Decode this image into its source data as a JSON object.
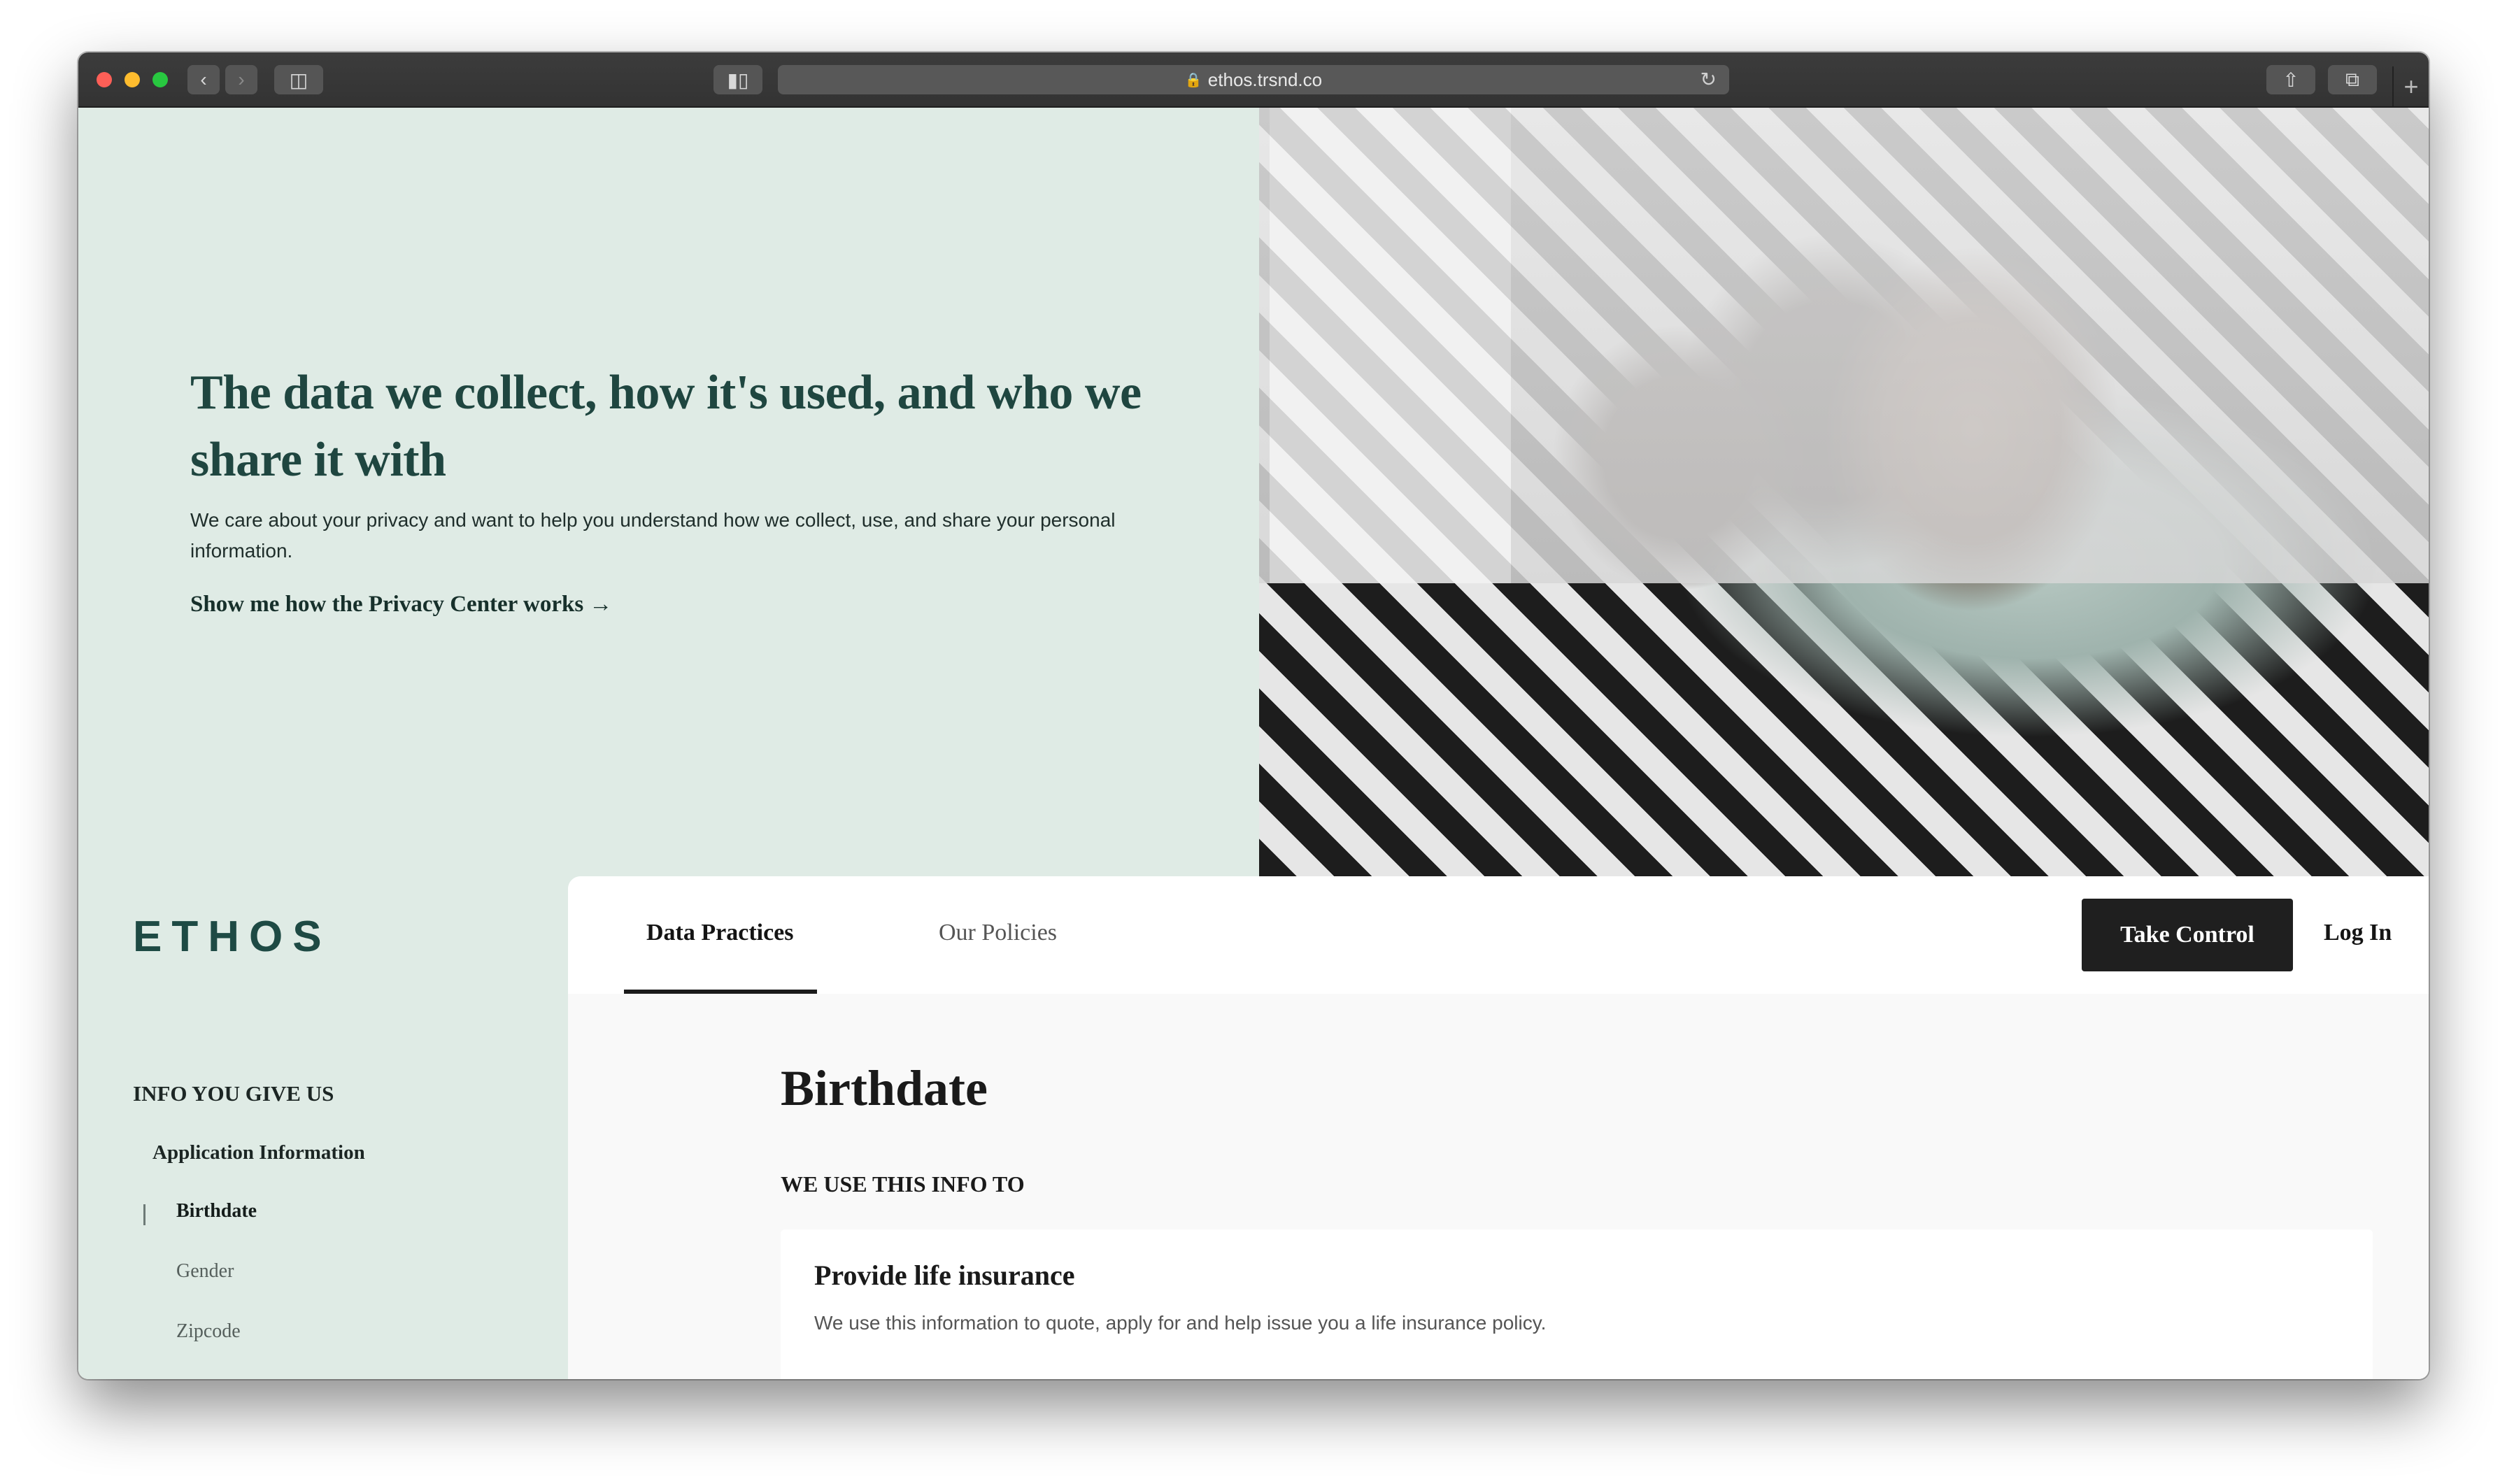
{
  "browser": {
    "url": "ethos.trsnd.co"
  },
  "hero": {
    "title": "The data we collect, how it's used, and who we share it with",
    "description": "We care about your privacy and want to help you understand how we collect, use, and share your personal information.",
    "link": "Show me how the Privacy Center works →"
  },
  "brand": {
    "logo": "ETHOS"
  },
  "sidebar": {
    "heading": "INFO YOU GIVE US",
    "subheading": "Application Information",
    "items": [
      {
        "label": "Birthdate",
        "active": true
      },
      {
        "label": "Gender",
        "active": false
      },
      {
        "label": "Zipcode",
        "active": false
      }
    ]
  },
  "nav": {
    "tabs": [
      {
        "label": "Data Practices",
        "active": true
      },
      {
        "label": "Our Policies",
        "active": false
      }
    ],
    "take_control": "Take Control",
    "login": "Log In"
  },
  "main": {
    "title": "Birthdate",
    "section_label": "WE USE THIS INFO TO",
    "card": {
      "title": "Provide life insurance",
      "description": "We use this information to quote, apply for and help issue you a life insurance policy."
    }
  },
  "colors": {
    "hero_bg": "#dfebe5",
    "brand_green": "#1e4a44",
    "button_dark": "#1f1f1f"
  }
}
